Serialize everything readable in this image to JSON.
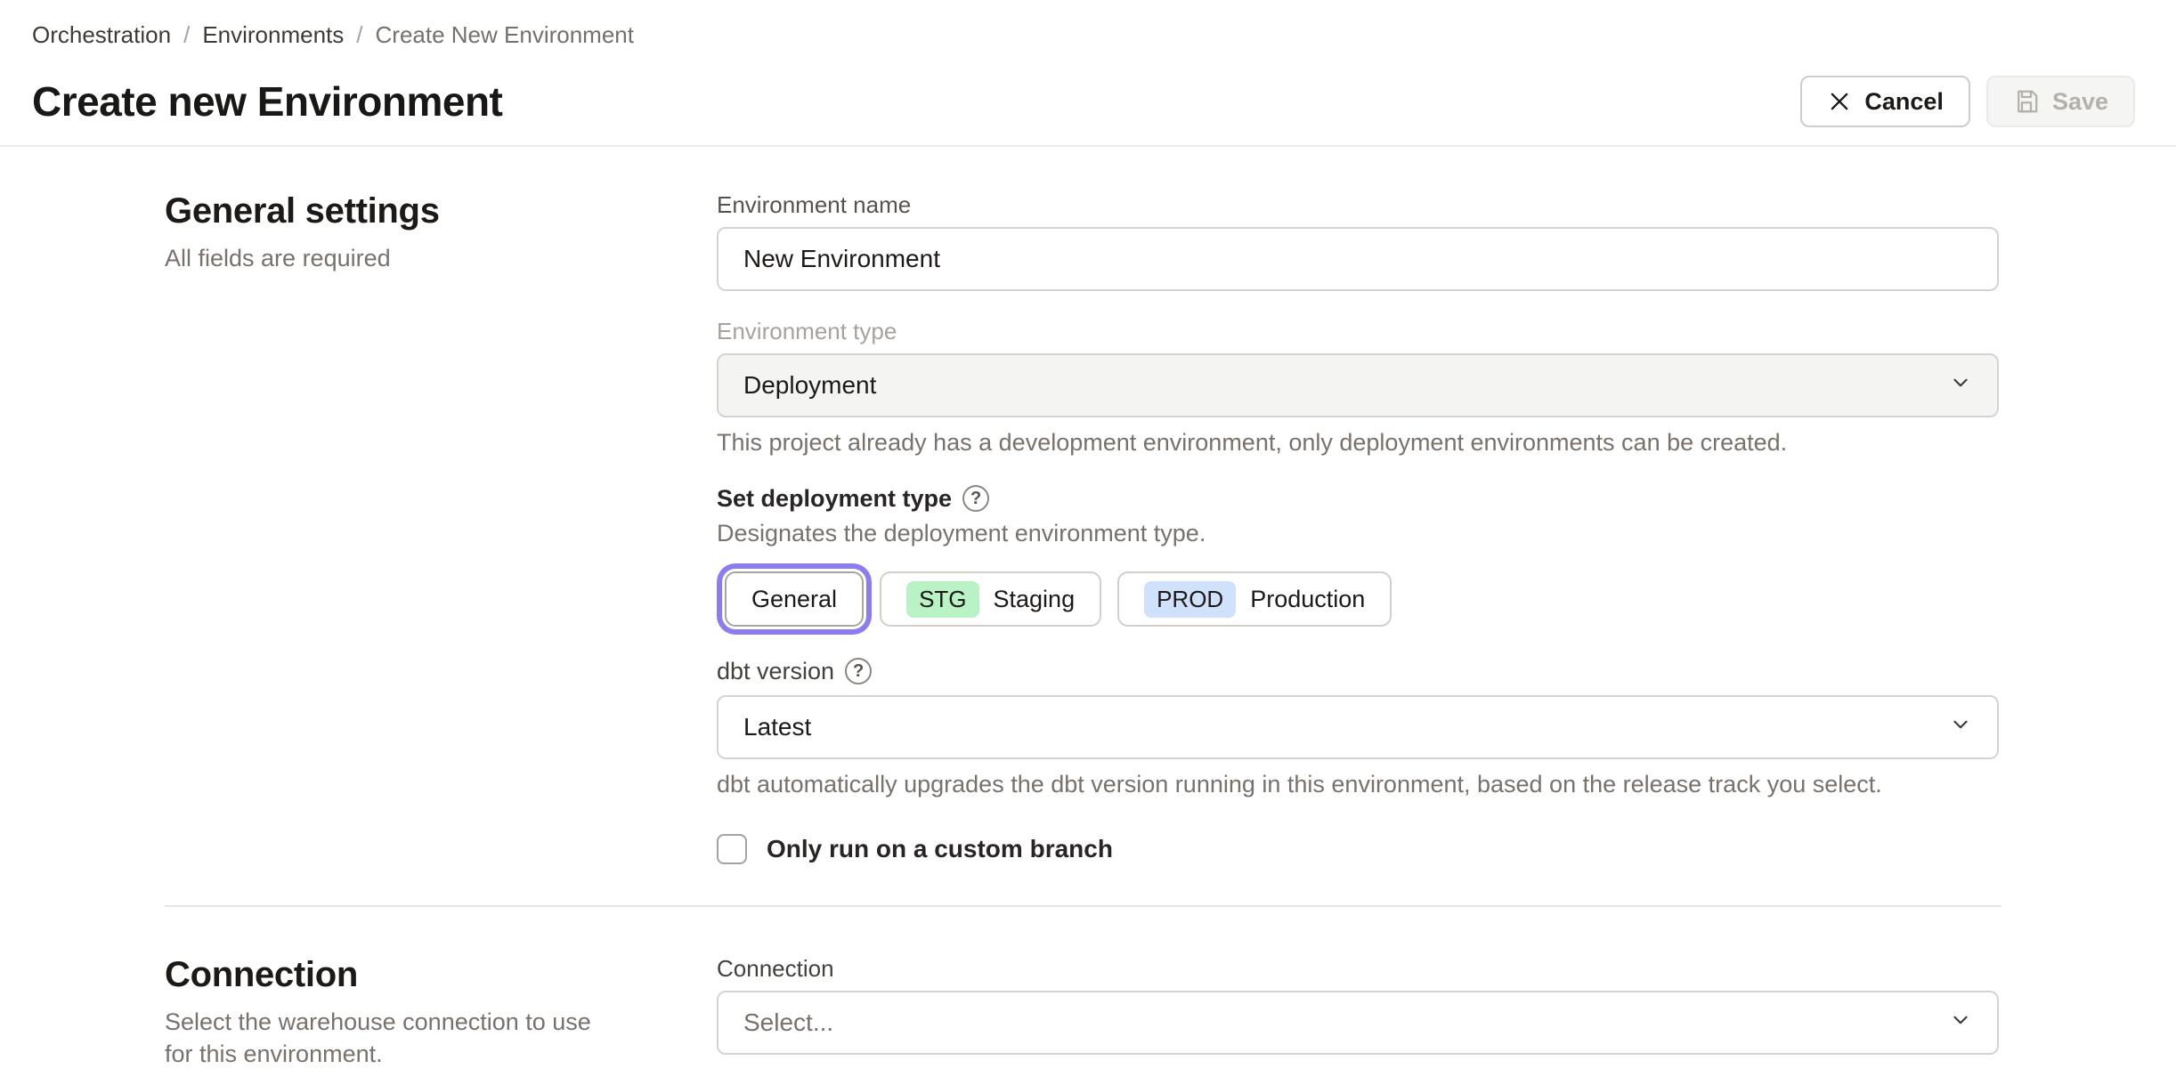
{
  "breadcrumb": {
    "separator": "/",
    "items": [
      {
        "label": "Orchestration"
      },
      {
        "label": "Environments"
      },
      {
        "label": "Create New Environment"
      }
    ]
  },
  "header": {
    "title": "Create new Environment",
    "cancel_label": "Cancel",
    "save_label": "Save"
  },
  "general_settings": {
    "heading": "General settings",
    "subheading": "All fields are required",
    "environment_name": {
      "label": "Environment name",
      "value": "New Environment"
    },
    "environment_type": {
      "label": "Environment type",
      "value": "Deployment",
      "disabled": true,
      "helper": "This project already has a development environment, only deployment environments can be created."
    },
    "deployment_type": {
      "label": "Set deployment type",
      "description": "Designates the deployment environment type.",
      "options": [
        {
          "label": "General",
          "selected": true
        },
        {
          "badge": "STG",
          "label": "Staging",
          "selected": false
        },
        {
          "badge": "PROD",
          "label": "Production",
          "selected": false
        }
      ]
    },
    "dbt_version": {
      "label": "dbt version",
      "value": "Latest",
      "helper": "dbt automatically upgrades the dbt version running in this environment, based on the release track you select."
    },
    "custom_branch": {
      "label": "Only run on a custom branch",
      "checked": false
    }
  },
  "connection_section": {
    "heading": "Connection",
    "description": "Select the warehouse connection to use for this environment.",
    "connection": {
      "label": "Connection",
      "placeholder": "Select..."
    }
  },
  "icons": {
    "cancel": "x-icon",
    "save": "floppy-disk-icon",
    "help": "?",
    "chevron": "chevron-down-icon"
  },
  "colors": {
    "accent_purple": "#8b7cf2",
    "badge_staging_bg": "#b9f2c4",
    "badge_production_bg": "#cfe1fb",
    "divider": "#e7e5e4"
  }
}
